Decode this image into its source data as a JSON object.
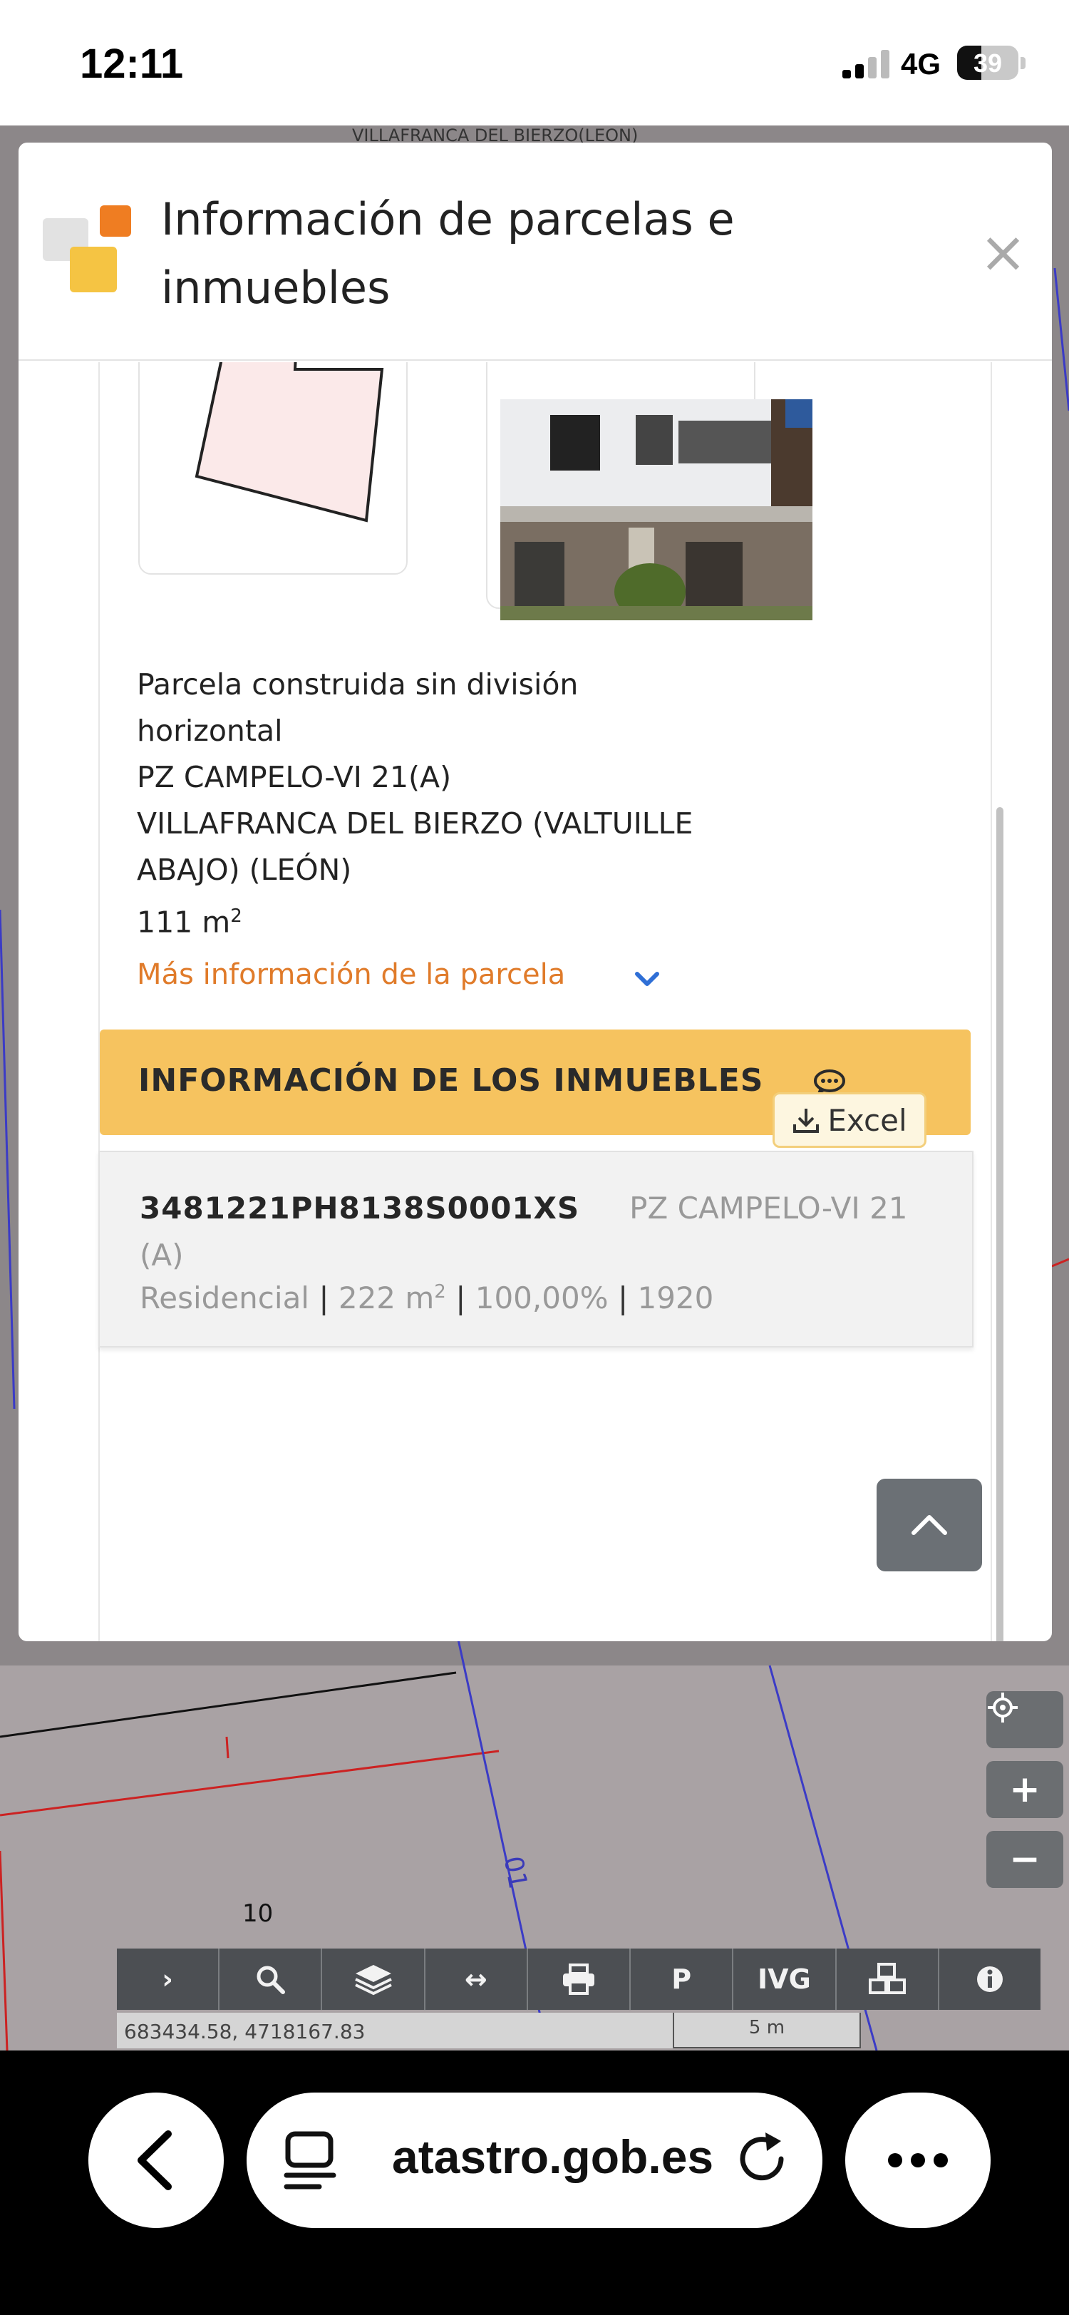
{
  "status_bar": {
    "time": "12:11",
    "network": "4G",
    "battery": "39",
    "battery_level": 0.39
  },
  "map": {
    "top_label": "VILLAFRANCA DEL BIERZO(LEON)",
    "parcel_number": "10",
    "side_label": "01",
    "coordinates": "683434.58, 4718167.83",
    "scale": "5 m",
    "controls": {
      "locate": "locate-icon",
      "zoom_in": "+",
      "zoom_out": "−"
    },
    "toolbar": [
      {
        "name": "expand",
        "label": "›"
      },
      {
        "name": "search",
        "label": ""
      },
      {
        "name": "layers",
        "label": ""
      },
      {
        "name": "measure",
        "label": "↔"
      },
      {
        "name": "print",
        "label": ""
      },
      {
        "name": "parking",
        "label": "P"
      },
      {
        "name": "ivg",
        "label": "IVG"
      },
      {
        "name": "blocks",
        "label": ""
      },
      {
        "name": "info",
        "label": ""
      }
    ]
  },
  "modal": {
    "title": "Información de parcelas e inmuebles",
    "close": "×",
    "parcel": {
      "type_line1": "Parcela construida sin división",
      "type_line2": "horizontal",
      "address": "PZ CAMPELO-VI 21(A)",
      "municipality_line1": "VILLAFRANCA DEL BIERZO (VALTUILLE",
      "municipality_line2": "ABAJO) (LEÓN)",
      "area": "111 m",
      "area_exp": "2",
      "more_info": "Más información de la parcela"
    },
    "inmuebles": {
      "heading": "INFORMACIÓN DE LOS INMUEBLES",
      "excel_label": "Excel",
      "rows": [
        {
          "ref": "3481221PH8138S0001XS",
          "address": "PZ CAMPELO-VI 21 (A)",
          "use": "Residencial",
          "area": "222 m",
          "area_exp": "2",
          "share": "100,00%",
          "year": "1920"
        }
      ]
    }
  },
  "browser": {
    "url": "atastro.gob.es"
  },
  "colors": {
    "accent_orange": "#e07b2a",
    "header_yellow": "#f6c35f",
    "link_blue": "#2f6fd6"
  }
}
